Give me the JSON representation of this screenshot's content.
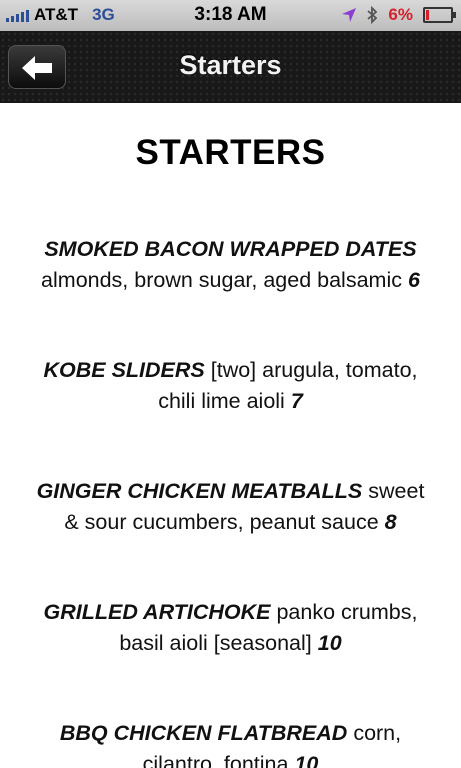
{
  "status_bar": {
    "carrier": "AT&T",
    "network": "3G",
    "time": "3:18 AM",
    "battery_percent": "6%"
  },
  "nav": {
    "title": "Starters",
    "back_icon": "back-arrow-icon"
  },
  "page": {
    "heading": "STARTERS",
    "items": [
      {
        "name": "SMOKED BACON WRAPPED DATES",
        "line2": "almonds, brown sugar, aged balsamic",
        "price": "6"
      },
      {
        "name": "KOBE SLIDERS",
        "desc1": "[two] arugula, tomato,",
        "desc2": "chili lime aioli",
        "price": "7"
      },
      {
        "name": "GINGER CHICKEN MEATBALLS",
        "desc1": "sweet",
        "desc2": "& sour cucumbers, peanut sauce",
        "price": "8"
      },
      {
        "name": "GRILLED ARTICHOKE",
        "desc1": "panko crumbs,",
        "desc2": "basil aioli [seasonal]",
        "price": "10"
      },
      {
        "name": "BBQ CHICKEN FLATBREAD",
        "desc1": "corn,",
        "desc2": "cilantro, fontina",
        "price": "10"
      }
    ]
  },
  "colors": {
    "network": "#2a4f96",
    "battery": "#d6202a",
    "navbar": "#181818"
  }
}
